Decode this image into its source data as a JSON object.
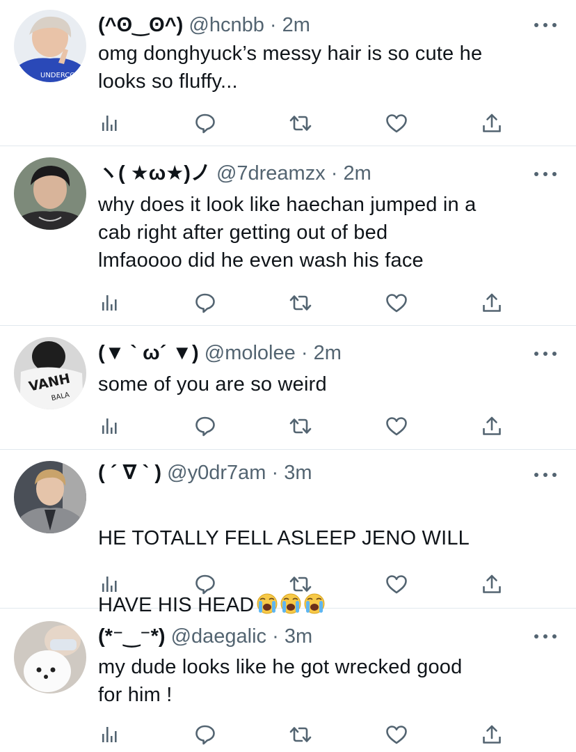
{
  "tweets": [
    {
      "name": "(^ʘ‿ʘ^)",
      "handle": "@hcnbb",
      "separator": "·",
      "time": "2m",
      "text": "omg donghyuck’s messy hair is so cute he\nlooks so fluffy...",
      "avatar_caption": "UNDERCOVER"
    },
    {
      "name": "ヽ( ★ω★)ノ",
      "handle": "@7dreamzx",
      "separator": "·",
      "time": "2m",
      "text": "why does it look like haechan jumped in a\ncab right after getting out of bed\nlmfaoooo did he even wash his face"
    },
    {
      "name": "(▼ ` ω´ ▼)",
      "handle": "@mololee",
      "separator": "·",
      "time": "2m",
      "text": "some of you are so weird",
      "avatar_caption": "VANH",
      "avatar_caption2": "BALA"
    },
    {
      "name": "( ´ ∇ ` )",
      "handle": "@y0dr7am",
      "separator": "·",
      "time": "3m",
      "text_line1": "HE TOTALLY FELL ASLEEP JENO WILL",
      "text_line2": "HAVE HIS HEAD",
      "emoji": [
        "loudly-crying-face",
        "loudly-crying-face",
        "loudly-crying-face"
      ]
    },
    {
      "name": "(*⁻‿⁻*)",
      "handle": "@daegalic",
      "separator": "·",
      "time": "3m",
      "text": "my dude looks like he got wrecked good\nfor him !"
    }
  ],
  "action_icons": [
    "analytics-icon",
    "reply-icon",
    "retweet-icon",
    "like-icon",
    "share-icon"
  ],
  "colors": {
    "text": "#0f1419",
    "secondary": "#536471",
    "divider": "#e1e8ed",
    "background": "#ffffff"
  }
}
